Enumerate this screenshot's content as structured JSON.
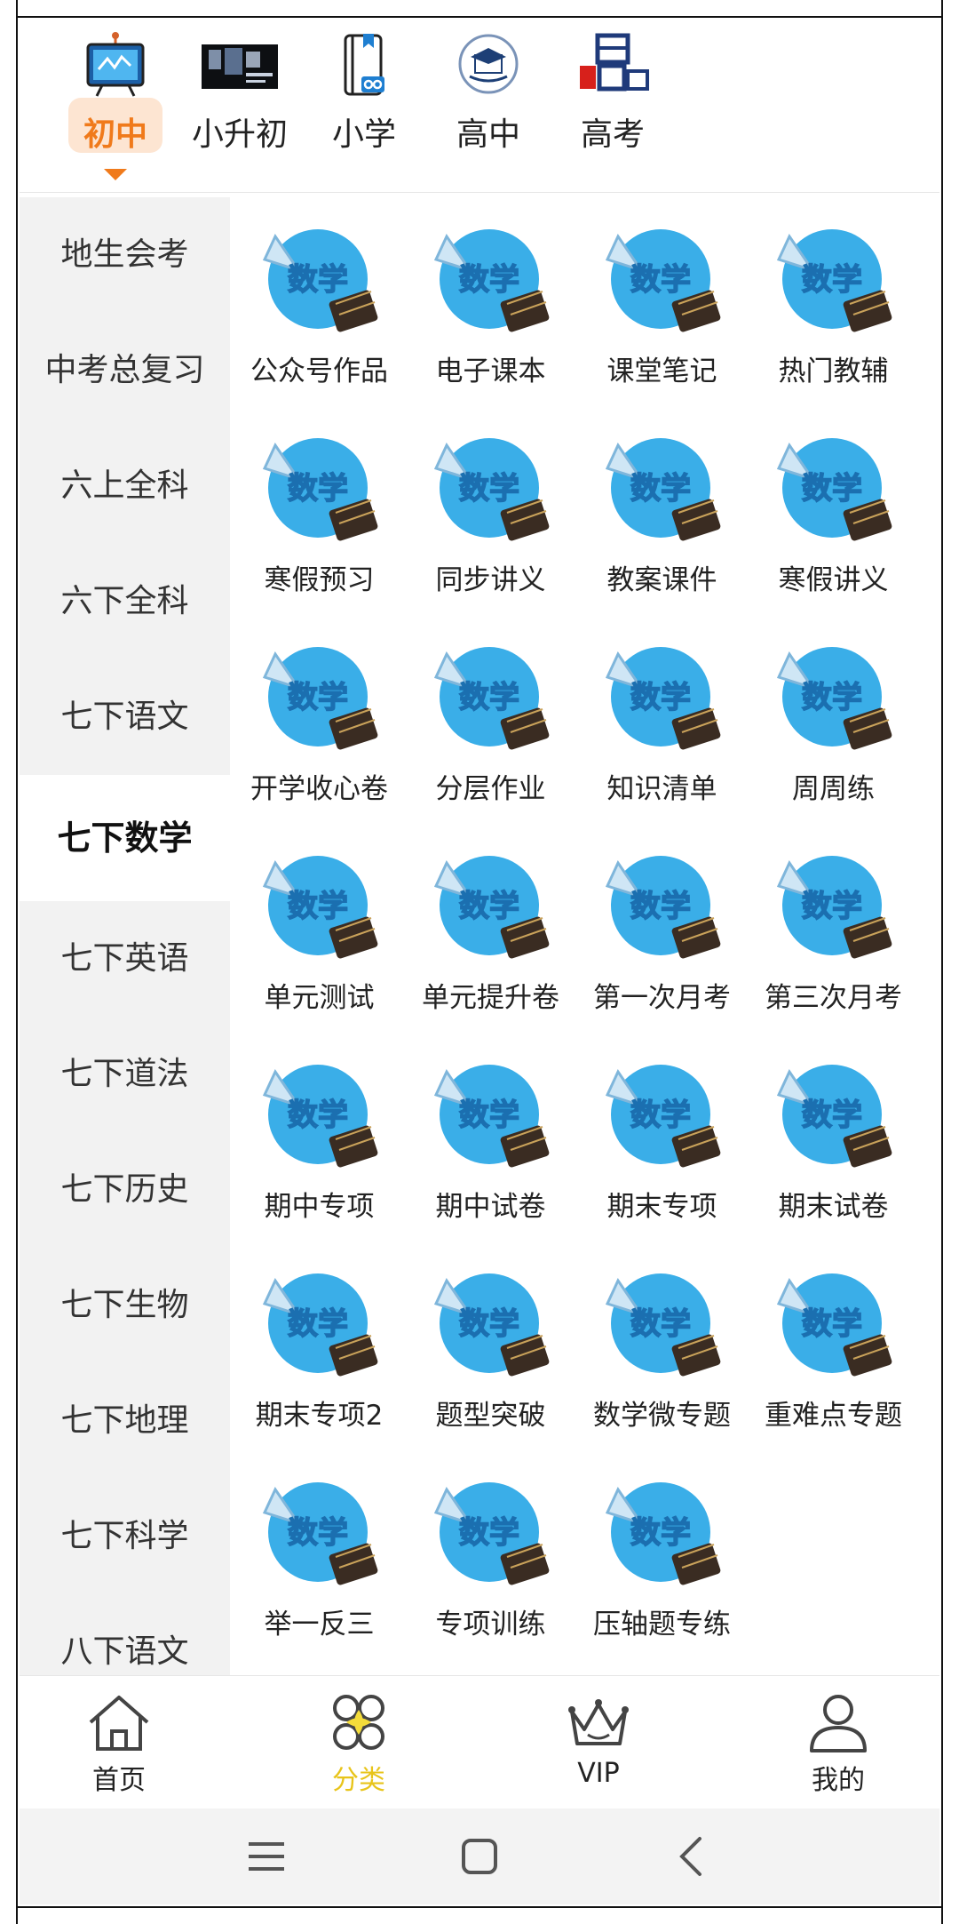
{
  "level_tabs": [
    {
      "label": "初中",
      "icon": "whiteboard-icon",
      "active": true
    },
    {
      "label": "小升初",
      "icon": "study-photo-icon",
      "active": false
    },
    {
      "label": "小学",
      "icon": "book-link-icon",
      "active": false
    },
    {
      "label": "高中",
      "icon": "graduation-cap-icon",
      "active": false
    },
    {
      "label": "高考",
      "icon": "gaokao-logo-icon",
      "active": false
    }
  ],
  "sidebar": {
    "items": [
      "地生会考",
      "中考总复习",
      "六上全科",
      "六下全科",
      "七下语文",
      "七下数学",
      "七下英语",
      "七下道法",
      "七下历史",
      "七下生物",
      "七下地理",
      "七下科学",
      "八下语文"
    ],
    "active_index": 5
  },
  "badge": {
    "text": "数学"
  },
  "grid": {
    "items": [
      "公众号作品",
      "电子课本",
      "课堂笔记",
      "热门教辅",
      "寒假预习",
      "同步讲义",
      "教案课件",
      "寒假讲义",
      "开学收心卷",
      "分层作业",
      "知识清单",
      "周周练",
      "单元测试",
      "单元提升卷",
      "第一次月考",
      "第三次月考",
      "期中专项",
      "期中试卷",
      "期末专项",
      "期末试卷",
      "期末专项2",
      "题型突破",
      "数学微专题",
      "重难点专题",
      "举一反三",
      "专项训练",
      "压轴题专练"
    ]
  },
  "bottom_nav": [
    {
      "label": "首页",
      "icon": "home-icon",
      "active": false
    },
    {
      "label": "分类",
      "icon": "category-icon",
      "active": true
    },
    {
      "label": "VIP",
      "icon": "crown-icon",
      "active": false
    },
    {
      "label": "我的",
      "icon": "person-icon",
      "active": false
    }
  ],
  "colors": {
    "accent": "#f07a1b",
    "active_nav": "#e8c41a",
    "badge_blue": "#3aaee8"
  }
}
